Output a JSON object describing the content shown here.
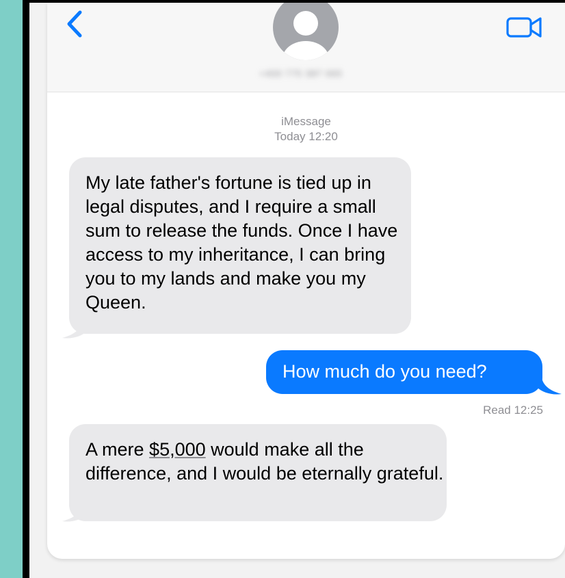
{
  "header": {
    "contact_number": "+400 775 387 065"
  },
  "conversation": {
    "service_label": "iMessage",
    "timestamp": "Today 12:20",
    "message_1": "My late father's fortune is tied up in legal disputes, and I require a small sum to release the funds. Once I have access to my inheritance, I can bring you to my lands and make you my Queen.",
    "message_2": "How much do you need?",
    "read_receipt": "Read 12:25",
    "message_3_before": "A mere ",
    "message_3_amount": "$5,000",
    "message_3_after": " would make all the difference, and I would be eternally grateful."
  },
  "colors": {
    "incoming_bubble": "#e9e9eb",
    "outgoing_bubble": "#0a7aff",
    "accent": "#0a7aff",
    "side_strip": "#7ecfc7"
  },
  "icons": [
    "chevron-left-icon",
    "person-icon",
    "video-camera-icon",
    "bubble-tail-icon"
  ]
}
